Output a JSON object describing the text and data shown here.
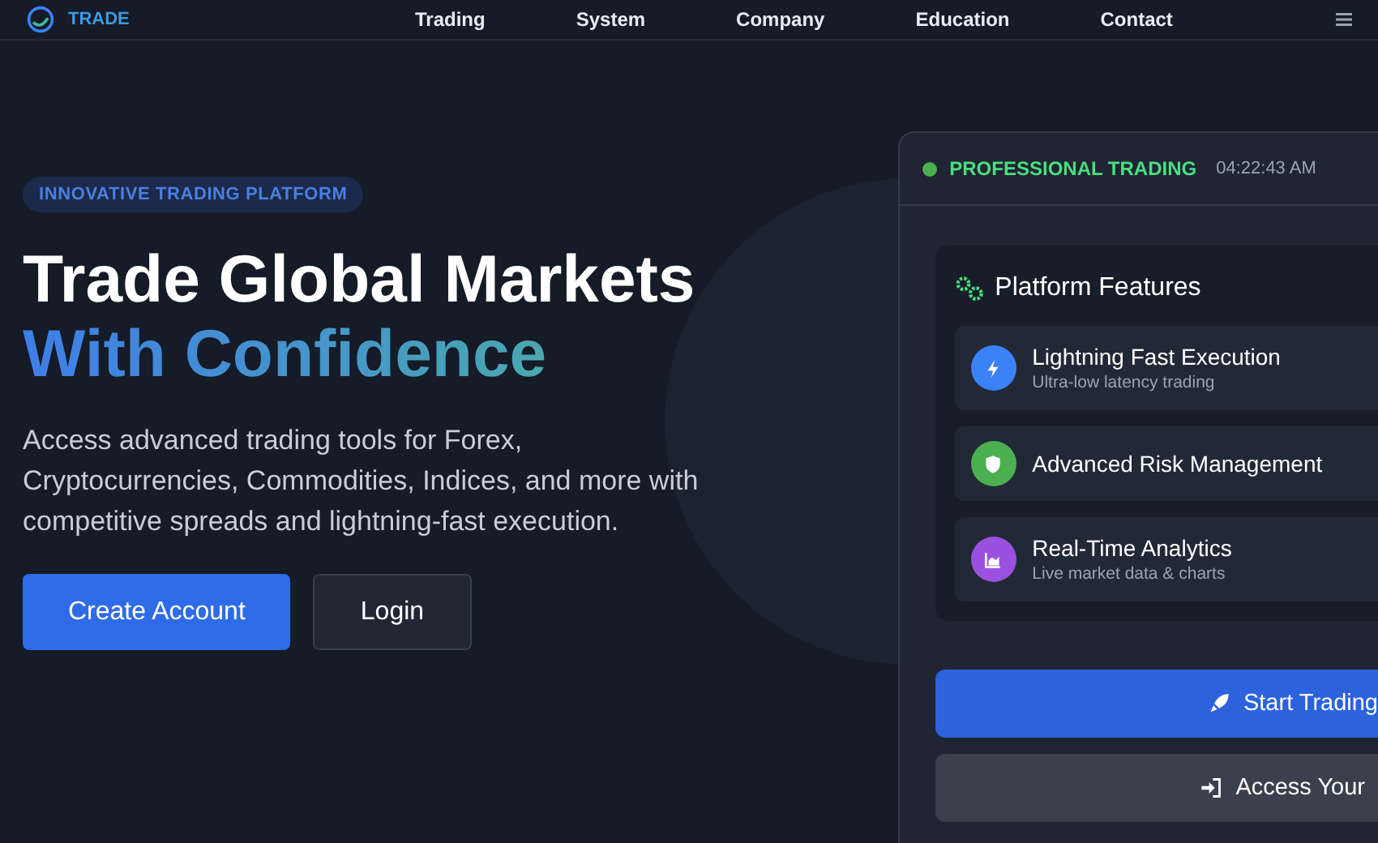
{
  "header": {
    "logo_text": "TRADE",
    "nav": [
      {
        "label": "Trading"
      },
      {
        "label": "System"
      },
      {
        "label": "Company"
      },
      {
        "label": "Education"
      },
      {
        "label": "Contact"
      }
    ]
  },
  "hero": {
    "badge": "INNOVATIVE TRADING PLATFORM",
    "title_line1": "Trade Global Markets",
    "title_line2": "With Confidence",
    "description": "Access advanced trading tools for Forex, Cryptocurrencies, Commodities, Indices, and more with competitive spreads and lightning-fast execution.",
    "buttons": [
      {
        "label": "Create Account",
        "kind": "primary"
      },
      {
        "label": "Login",
        "kind": "secondary"
      }
    ]
  },
  "panel": {
    "status": "PROFESSIONAL TRADING",
    "online": true,
    "time": "04:22:43 AM",
    "features_title": "Platform Features",
    "features": [
      {
        "title": "Lightning Fast Execution",
        "subtitle": "Ultra-low latency trading",
        "kind": "bolt",
        "color": "#3b82f6"
      },
      {
        "title": "Advanced Risk Management",
        "kind": "shield",
        "color": "#4caf50"
      },
      {
        "title": "Real-Time Analytics",
        "subtitle": "Live market data & charts",
        "kind": "chart",
        "color": "#9b51e0"
      }
    ],
    "buttons": [
      {
        "label": "Start Trading",
        "kind": "primary"
      },
      {
        "label": "Access Your",
        "kind": "secondary"
      }
    ]
  }
}
